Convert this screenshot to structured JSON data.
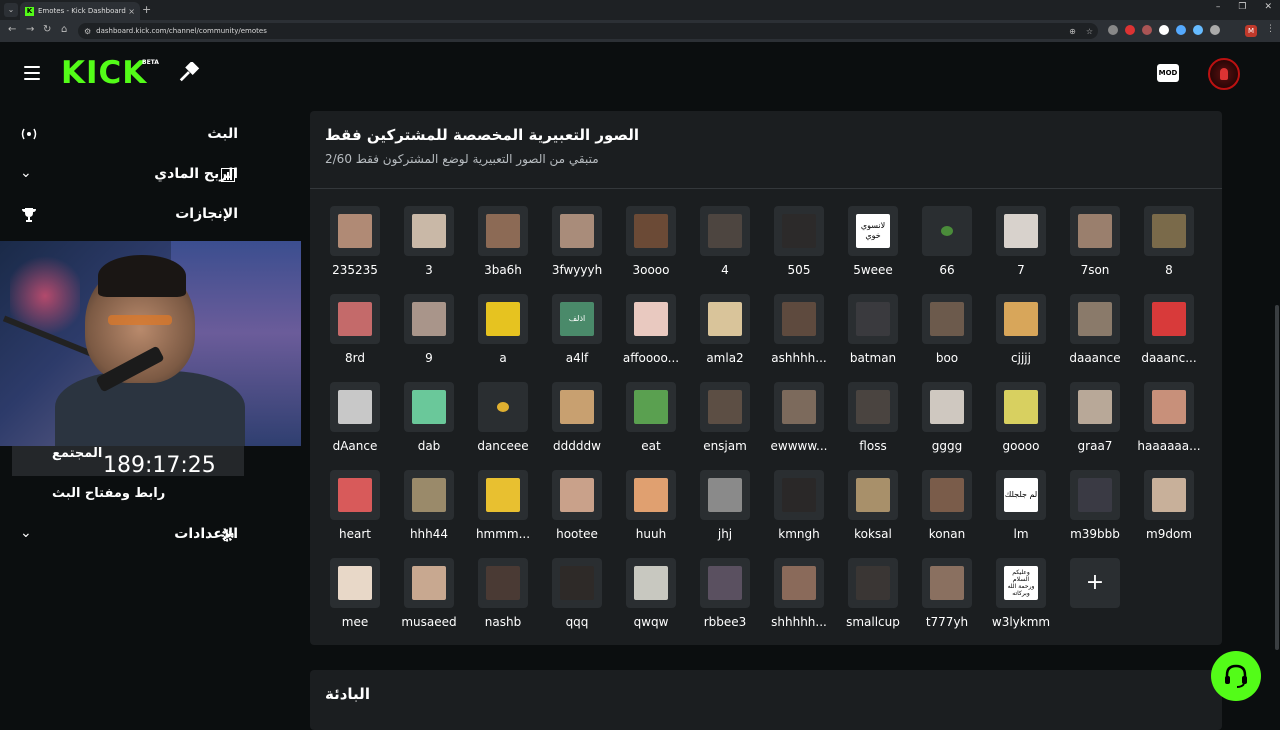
{
  "browser": {
    "tab_title": "Emotes - Kick Dashboard",
    "url": "dashboard.kick.com/channel/community/emotes"
  },
  "header": {
    "logo": "KICK",
    "beta": "BETA",
    "mod_label": "MOD"
  },
  "sidebar": {
    "items": [
      {
        "label": "البث"
      },
      {
        "label": "الربح المادي"
      },
      {
        "label": "الإنجازات"
      },
      {
        "label": "المجتمع"
      },
      {
        "label": "رابط ومفتاح البث"
      },
      {
        "label": "الإعدادات"
      }
    ]
  },
  "webcam": {
    "timer": "189:17:25"
  },
  "emotes_section": {
    "title": "الصور التعبيرية المخصصة للمشتركين فقط",
    "subtitle": "متبقي من الصور التعبيرية لوضع المشتركون فقط 2/60",
    "emotes": [
      {
        "name": "235235",
        "color": "#b08a75"
      },
      {
        "name": "3",
        "color": "#c9b8a7"
      },
      {
        "name": "3ba6h",
        "color": "#8c6a55"
      },
      {
        "name": "3fwyyyh",
        "color": "#a98c7a"
      },
      {
        "name": "3oooo",
        "color": "#6b4a36"
      },
      {
        "name": "4",
        "color": "#4d4540"
      },
      {
        "name": "505",
        "color": "#2c2a2a"
      },
      {
        "name": "5weee",
        "color": "#ffffff",
        "text": "لانسوي خوي"
      },
      {
        "name": "66",
        "color": "#2a2e31",
        "small": "#4a8c3a"
      },
      {
        "name": "7",
        "color": "#d8d2cc"
      },
      {
        "name": "7son",
        "color": "#9a7f6d"
      },
      {
        "name": "8",
        "color": "#7a6a4a"
      },
      {
        "name": "8rd",
        "color": "#c46a6a"
      },
      {
        "name": "9",
        "color": "#a9958a"
      },
      {
        "name": "a",
        "color": "#e6c320"
      },
      {
        "name": "a4lf",
        "color": "#4a8a6a",
        "text": "اذلف"
      },
      {
        "name": "affoooo...",
        "color": "#e9c9c0"
      },
      {
        "name": "amla2",
        "color": "#d9c49a"
      },
      {
        "name": "ashhhh...",
        "color": "#5e4a3e"
      },
      {
        "name": "batman",
        "color": "#3a3a3e"
      },
      {
        "name": "boo",
        "color": "#6c5a4c"
      },
      {
        "name": "cjjjj",
        "color": "#d8a65a"
      },
      {
        "name": "daaance",
        "color": "#8a7a6a"
      },
      {
        "name": "daaanc...",
        "color": "#d83a3a"
      },
      {
        "name": "dAance",
        "color": "#c8c8c8"
      },
      {
        "name": "dab",
        "color": "#6ac89a"
      },
      {
        "name": "danceee",
        "color": "#2a2e31",
        "small": "#e0b030"
      },
      {
        "name": "dddddw",
        "color": "#c8a070"
      },
      {
        "name": "eat",
        "color": "#5aa050"
      },
      {
        "name": "ensjam",
        "color": "#5c4e44"
      },
      {
        "name": "ewwww...",
        "color": "#7c6a5c"
      },
      {
        "name": "floss",
        "color": "#4a4440"
      },
      {
        "name": "gggg",
        "color": "#cfc8c0"
      },
      {
        "name": "goooo",
        "color": "#d8d060"
      },
      {
        "name": "graa7",
        "color": "#b8a898"
      },
      {
        "name": "haaaaaa...",
        "color": "#c8907a"
      },
      {
        "name": "heart",
        "color": "#d85a5a"
      },
      {
        "name": "hhh44",
        "color": "#9a8a6a"
      },
      {
        "name": "hmmm...",
        "color": "#e8c030"
      },
      {
        "name": "hootee",
        "color": "#c9a18a"
      },
      {
        "name": "huuh",
        "color": "#e0a070"
      },
      {
        "name": "jhj",
        "color": "#8a8a8a"
      },
      {
        "name": "kmngh",
        "color": "#2a2828"
      },
      {
        "name": "koksal",
        "color": "#a8906a"
      },
      {
        "name": "konan",
        "color": "#7a5c4a"
      },
      {
        "name": "lm",
        "color": "#ffffff",
        "text": "لم جلجلك"
      },
      {
        "name": "m39bbb",
        "color": "#3a3a44"
      },
      {
        "name": "m9dom",
        "color": "#c8b09a"
      },
      {
        "name": "mee",
        "color": "#e8d8c8"
      },
      {
        "name": "musaeed",
        "color": "#c8a890"
      },
      {
        "name": "nashb",
        "color": "#4a3a34"
      },
      {
        "name": "qqq",
        "color": "#2e2a28"
      },
      {
        "name": "qwqw",
        "color": "#c8c8c0"
      },
      {
        "name": "rbbee3",
        "color": "#5a5060"
      },
      {
        "name": "shhhhh...",
        "color": "#8a6a5a"
      },
      {
        "name": "smallcup",
        "color": "#3a3634"
      },
      {
        "name": "t777yh",
        "color": "#8a7060"
      },
      {
        "name": "w3lykmm",
        "color": "#ffffff",
        "text": "وعليكم السلام ورحمة الله وبركاته"
      }
    ]
  },
  "section2": {
    "title": "البادئة"
  }
}
